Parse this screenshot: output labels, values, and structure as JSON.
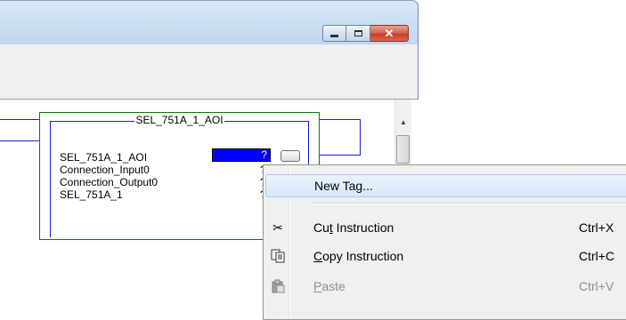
{
  "window": {
    "minimize_glyph": "",
    "maximize_glyph": "",
    "close_glyph": "✕"
  },
  "aoi_block": {
    "title": "SEL_751A_1_AOI",
    "params": [
      {
        "label": "SEL_751A_1_AOI",
        "value": "?"
      },
      {
        "label": "Connection_Input0",
        "value": "?"
      },
      {
        "label": "Connection_Output0",
        "value": "?"
      },
      {
        "label": "SEL_751A_1",
        "value": "?"
      }
    ]
  },
  "context_menu": {
    "items": [
      {
        "label": "New Tag...",
        "shortcut": "",
        "icon": "",
        "state": "highlighted"
      },
      {
        "label_pre": "Cu",
        "label_ul": "t",
        "label_post": " Instruction",
        "shortcut": "Ctrl+X",
        "icon": "scissors-icon",
        "state": "enabled"
      },
      {
        "label_pre": "",
        "label_ul": "C",
        "label_post": "opy Instruction",
        "shortcut": "Ctrl+C",
        "icon": "copy-icon",
        "state": "enabled"
      },
      {
        "label_pre": "",
        "label_ul": "P",
        "label_post": "aste",
        "shortcut": "Ctrl+V",
        "icon": "paste-icon",
        "state": "disabled"
      }
    ]
  },
  "colors": {
    "rung_line": "#1e1ed0",
    "block_border": "#0b7a0b",
    "selected_tag_fill": "#0000ff",
    "menu_highlight": "#d6e8fb"
  }
}
